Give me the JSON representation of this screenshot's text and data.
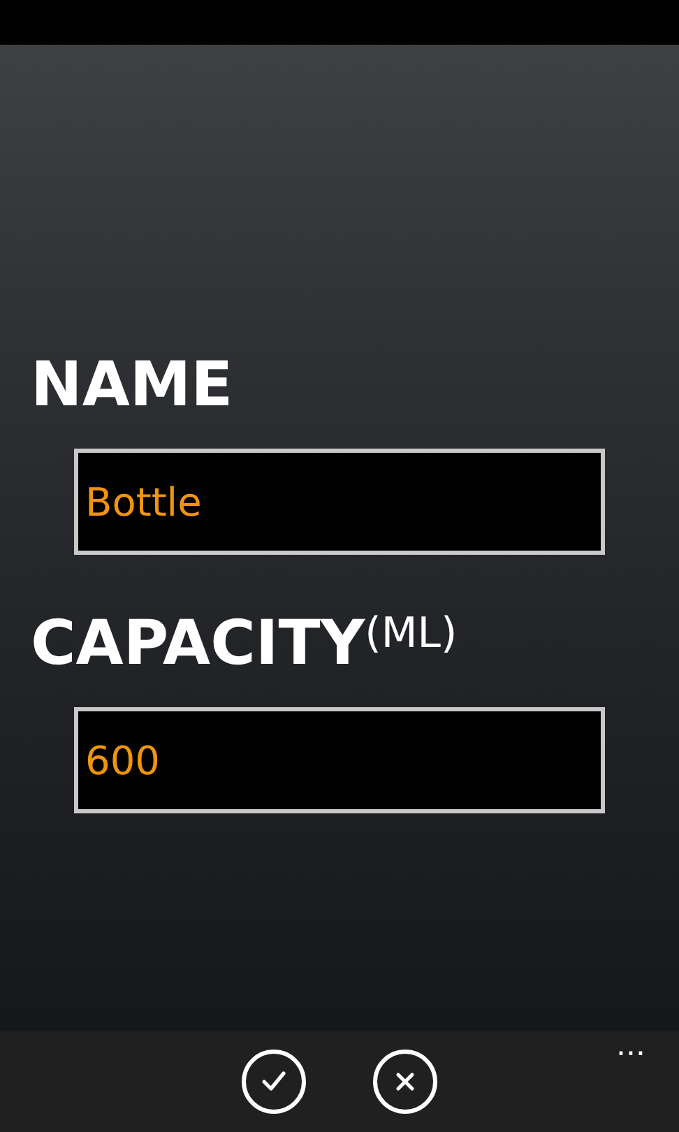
{
  "form": {
    "fields": [
      {
        "label": "NAME",
        "value": "Bottle"
      },
      {
        "label": "CAPACITY$^{(ML)}$",
        "value": "600"
      }
    ]
  },
  "app_bar": {
    "buttons": [
      {
        "kind": "check"
      },
      {
        "kind": "cancel"
      }
    ],
    "more": "..."
  }
}
